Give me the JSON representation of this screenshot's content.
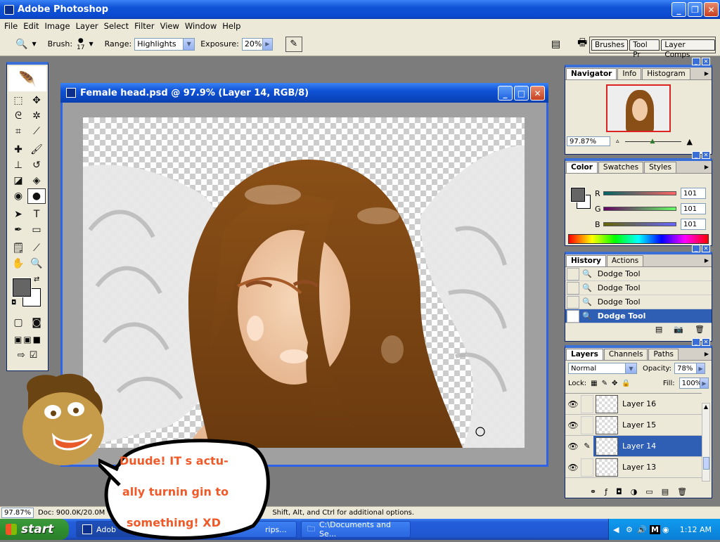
{
  "app": {
    "title": "Adobe Photoshop"
  },
  "menu": [
    "File",
    "Edit",
    "Image",
    "Layer",
    "Select",
    "Filter",
    "View",
    "Window",
    "Help"
  ],
  "options": {
    "brush_label": "Brush:",
    "brush_size": "17",
    "range_label": "Range:",
    "range_value": "Highlights",
    "exposure_label": "Exposure:",
    "exposure_value": "20%",
    "tabs": [
      "Brushes",
      "Tool Pr",
      "Layer Comps"
    ]
  },
  "document": {
    "title": "Female head.psd @ 97.9% (Layer 14, RGB/8)"
  },
  "navigator": {
    "tabs": [
      "Navigator",
      "Info",
      "Histogram"
    ],
    "zoom": "97.87%"
  },
  "color": {
    "tabs": [
      "Color",
      "Swatches",
      "Styles"
    ],
    "channels": [
      {
        "label": "R",
        "value": "101"
      },
      {
        "label": "G",
        "value": "101"
      },
      {
        "label": "B",
        "value": "101"
      }
    ]
  },
  "history": {
    "tabs": [
      "History",
      "Actions"
    ],
    "items": [
      "Dodge Tool",
      "Dodge Tool",
      "Dodge Tool",
      "Dodge Tool"
    ]
  },
  "layers": {
    "tabs": [
      "Layers",
      "Channels",
      "Paths"
    ],
    "blend_mode": "Normal",
    "opacity_label": "Opacity:",
    "opacity": "78%",
    "lock_label": "Lock:",
    "fill_label": "Fill:",
    "fill": "100%",
    "items": [
      "Layer 16",
      "Layer 15",
      "Layer 14",
      "Layer 13"
    ]
  },
  "status": {
    "zoom": "97.87%",
    "doc": "Doc: 900.0K/20.0M",
    "hint": "Shift, Alt, and Ctrl for additional options."
  },
  "speech": {
    "line1": "Duude! IT s actu-",
    "line2": "ally turnin gin to",
    "line3": "something! XD"
  },
  "taskbar": {
    "start": "start",
    "tasks": [
      "Adob",
      "rips...",
      "C:\\Documents and Se..."
    ],
    "clock": "1:12 AM"
  }
}
